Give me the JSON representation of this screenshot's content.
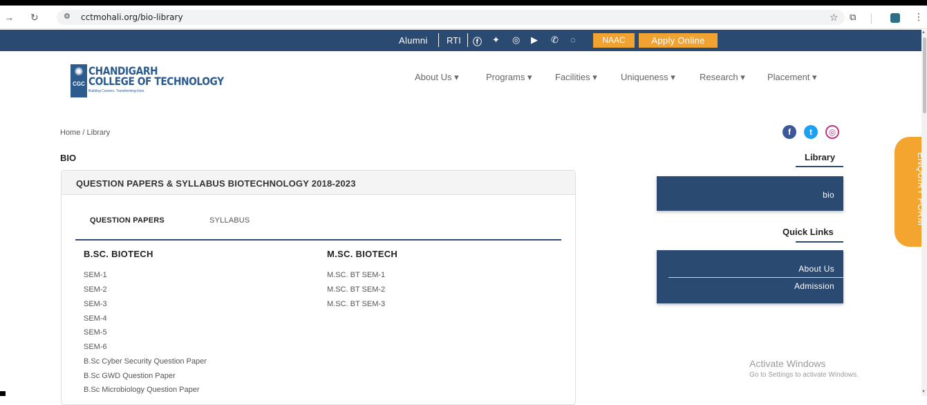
{
  "browser": {
    "url": "cctmohali.org/bio-library"
  },
  "topbar": {
    "alumni": "Alumni",
    "rti": "RTI",
    "naac": "NAAC",
    "apply": "Apply Online"
  },
  "logo": {
    "line1": "CHANDIGARH",
    "line2": "COLLEGE OF TECHNOLOGY",
    "badge": "CGC",
    "tagline": "Building Careers. Transforming lives."
  },
  "nav": [
    {
      "label": "About Us",
      "caret": "▾"
    },
    {
      "label": "Programs",
      "caret": "▾"
    },
    {
      "label": "Facilities",
      "caret": "▾"
    },
    {
      "label": "Uniqueness",
      "caret": "▾"
    },
    {
      "label": "Research",
      "caret": "▾"
    },
    {
      "label": "Placement",
      "caret": "▾"
    }
  ],
  "breadcrumb": "Home  / Library",
  "section_title": "BIO",
  "panel": {
    "title": "QUESTION PAPERS & SYLLABUS BIOTECHNOLOGY 2018-2023",
    "tabs": [
      "QUESTION PAPERS",
      "SYLLABUS"
    ],
    "columns": [
      {
        "heading": "B.SC. BIOTECH",
        "links": [
          "SEM-1",
          "SEM-2",
          "SEM-3",
          "SEM-4",
          "SEM-5",
          "SEM-6",
          "B.Sc Cyber Security Question Paper",
          "B.Sc GWD Question Paper",
          "B.Sc Microbiology Question Paper"
        ]
      },
      {
        "heading": "M.SC. BIOTECH",
        "links": [
          "M.SC. BT SEM-1",
          "M.SC. BT SEM-2",
          "M.SC. BT SEM-3"
        ]
      }
    ]
  },
  "sidebar": {
    "library_heading": "Library",
    "library_items": [
      "bio"
    ],
    "quicklinks_heading": "Quick Links",
    "quicklinks_items": [
      "About Us",
      "Admission"
    ]
  },
  "enquiry": "ENQUIRY FORM",
  "watermark": {
    "line1": "Activate Windows",
    "line2": "Go to Settings to activate Windows."
  },
  "colors": {
    "brand_blue": "#2b4a72",
    "accent_orange": "#f0a331"
  }
}
